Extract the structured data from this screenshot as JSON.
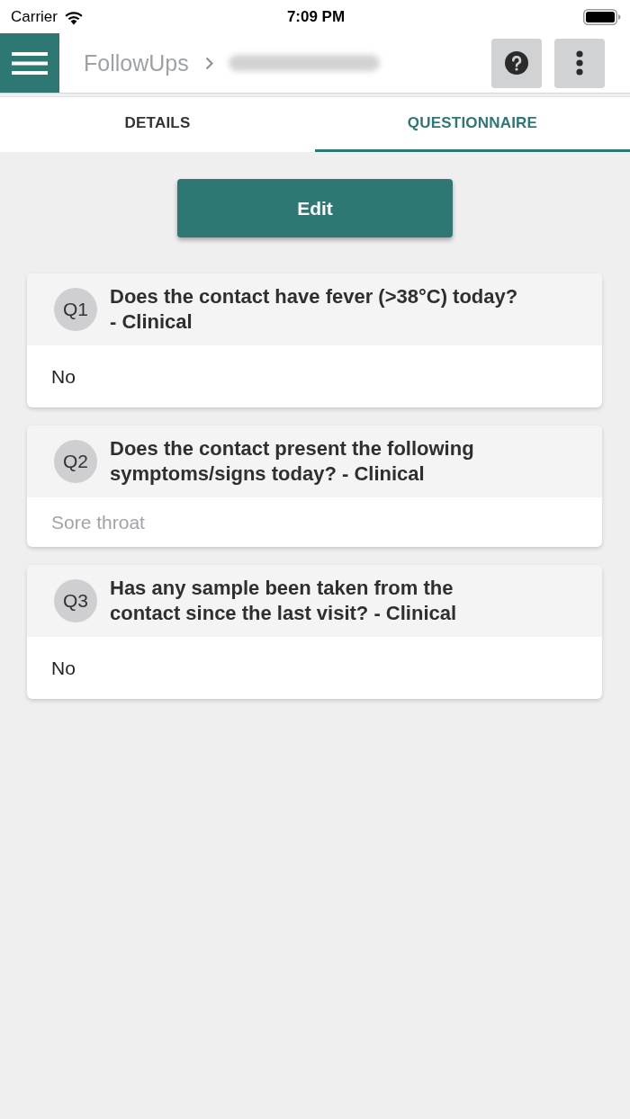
{
  "status_bar": {
    "carrier": "Carrier",
    "time": "7:09 PM"
  },
  "header": {
    "breadcrumb": "FollowUps"
  },
  "tabs": [
    {
      "label": "DETAILS",
      "selected": false
    },
    {
      "label": "QUESTIONNAIRE",
      "selected": true
    }
  ],
  "edit_button": {
    "label": "Edit"
  },
  "questions": [
    {
      "number": "Q1",
      "text": "Does the contact have fever (>38°C) today? - Clinical",
      "answer": {
        "text": "No",
        "greyed": false
      }
    },
    {
      "number": "Q2",
      "text": "Does the contact present the following symptoms/signs today? - Clinical",
      "answer": {
        "text": "Sore throat",
        "greyed": true
      }
    },
    {
      "number": "Q3",
      "text": "Has any sample been taken from the contact since the last visit? - Clinical",
      "answer": {
        "text": "No",
        "greyed": false
      }
    }
  ]
}
